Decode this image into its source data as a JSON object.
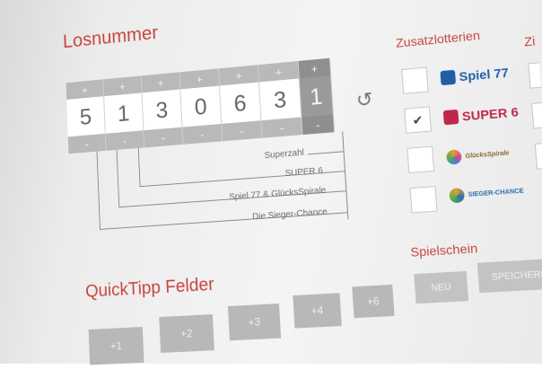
{
  "losnummer": {
    "title": "Losnummer",
    "plus": "+",
    "minus": "-",
    "digits": [
      "5",
      "1",
      "3",
      "0",
      "6",
      "3"
    ],
    "superzahl": "1",
    "labels": {
      "superzahl": "Superzahl",
      "super6": "SUPER 6",
      "spiel77": "Spiel 77 & GlücksSpirale",
      "sieger": "Die Sieger-Chance"
    }
  },
  "zusatzlotterien": {
    "title": "Zusatzlotterien",
    "items": [
      {
        "label": "Spiel 77",
        "checked": false,
        "color": "#1f5fa8"
      },
      {
        "label": "SUPER 6",
        "checked": true,
        "color": "#c0284a"
      },
      {
        "label": "GlücksSpirale",
        "checked": false,
        "color": "#e0a02a"
      },
      {
        "label": "SIEGER-CHANCE",
        "checked": false,
        "color": "#2a6fb0"
      }
    ],
    "check_mark": "✔"
  },
  "cut_title": "Zi",
  "quicktipp": {
    "title": "QuickTipp Felder",
    "buttons": [
      "+1",
      "+2",
      "+3",
      "+4",
      "+6"
    ]
  },
  "spielschein": {
    "title": "Spielschein",
    "buttons": [
      "NEU",
      "SPEICHERN"
    ]
  },
  "colors": {
    "accent_red": "#c8453f",
    "grid_gray": "#b9b9b9"
  }
}
